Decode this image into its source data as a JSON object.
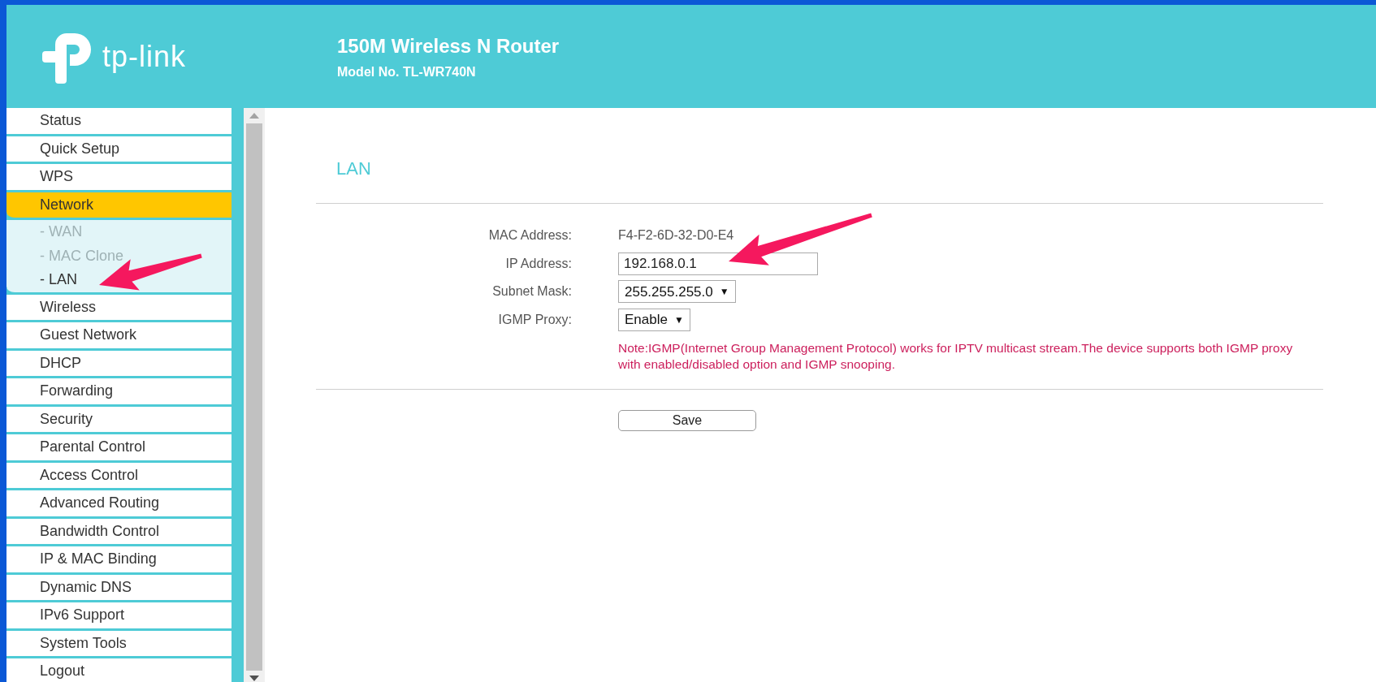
{
  "header": {
    "logo_text": "tp-link",
    "title": "150M Wireless N Router",
    "model": "Model No. TL-WR740N"
  },
  "sidebar": {
    "items": [
      {
        "label": "Status",
        "selected": false
      },
      {
        "label": "Quick Setup",
        "selected": false
      },
      {
        "label": "WPS",
        "selected": false
      },
      {
        "label": "Network",
        "selected": true,
        "children": [
          {
            "label": "- WAN",
            "selected": false
          },
          {
            "label": "- MAC Clone",
            "selected": false
          },
          {
            "label": "- LAN",
            "selected": true
          }
        ]
      },
      {
        "label": "Wireless",
        "selected": false
      },
      {
        "label": "Guest Network",
        "selected": false
      },
      {
        "label": "DHCP",
        "selected": false
      },
      {
        "label": "Forwarding",
        "selected": false
      },
      {
        "label": "Security",
        "selected": false
      },
      {
        "label": "Parental Control",
        "selected": false
      },
      {
        "label": "Access Control",
        "selected": false
      },
      {
        "label": "Advanced Routing",
        "selected": false
      },
      {
        "label": "Bandwidth Control",
        "selected": false
      },
      {
        "label": "IP & MAC Binding",
        "selected": false
      },
      {
        "label": "Dynamic DNS",
        "selected": false
      },
      {
        "label": "IPv6 Support",
        "selected": false
      },
      {
        "label": "System Tools",
        "selected": false
      },
      {
        "label": "Logout",
        "selected": false
      }
    ]
  },
  "section_title": "LAN",
  "fields": [
    {
      "kind": "text",
      "label": "MAC Address:",
      "value": "F4-F2-6D-32-D0-E4"
    },
    {
      "kind": "input",
      "label": "IP Address:",
      "value": "192.168.0.1"
    },
    {
      "kind": "select",
      "label": "Subnet Mask:",
      "value": "255.255.255.0",
      "caret": "▼"
    },
    {
      "kind": "select",
      "label": "IGMP Proxy:",
      "value": "Enable",
      "caret": "▼"
    }
  ],
  "note": "Note:IGMP(Internet Group Management Protocol) works for IPTV multicast stream.The device supports both IGMP proxy with enabled/disabled option and IGMP snooping.",
  "save_button": "Save"
}
